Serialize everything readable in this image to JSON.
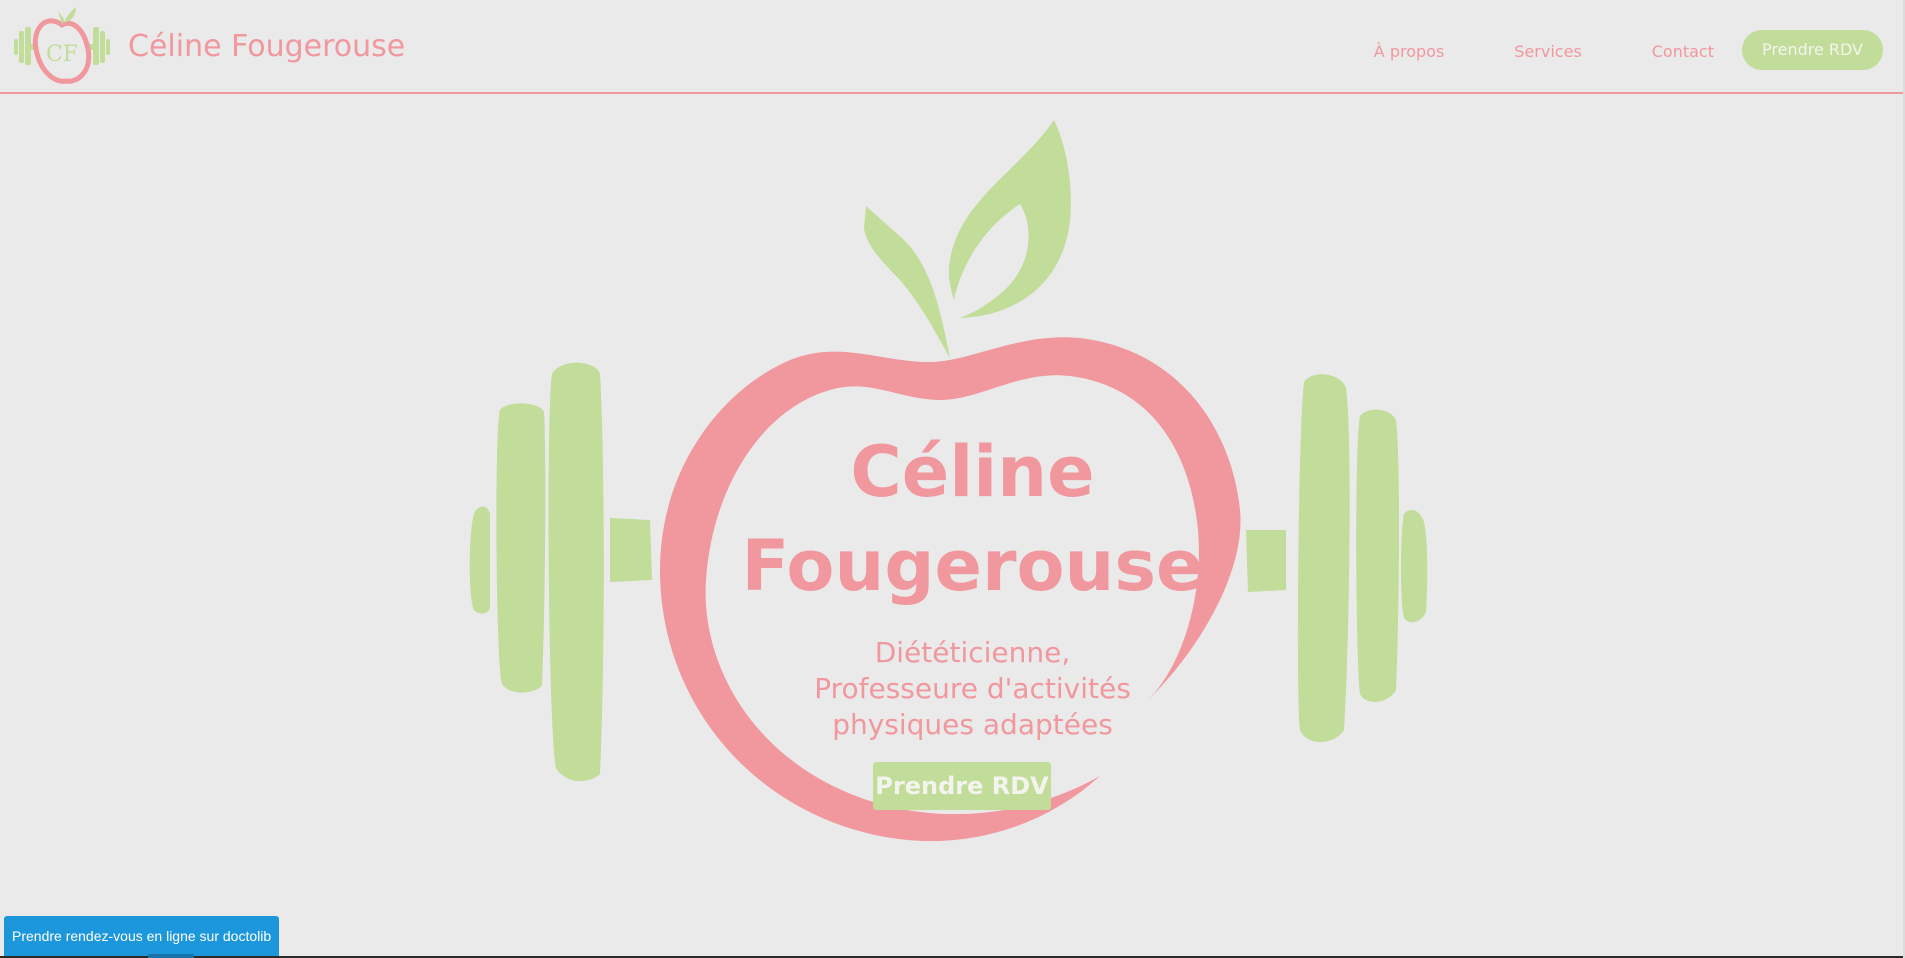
{
  "brand": {
    "name": "Céline Fougerouse",
    "logo_initials": "CF",
    "logo_icon": "apple-dumbbell-logo-icon"
  },
  "nav": {
    "items": [
      {
        "label": "À propos"
      },
      {
        "label": "Services"
      },
      {
        "label": "Contact"
      }
    ],
    "cta_label": "Prendre RDV"
  },
  "hero": {
    "name_line1": "Céline",
    "name_line2": "Fougerouse",
    "subtitle_line1": "Diététicienne,",
    "subtitle_line2": "Professeure d'activités",
    "subtitle_line3": "physiques adaptées",
    "cta_label": "Prendre RDV",
    "art_icon": "apple-dumbbell-illustration"
  },
  "doctolib": {
    "label": "Prendre rendez-vous en ligne sur doctolib"
  },
  "colors": {
    "pink": "#f1979e",
    "green": "#c2dc99",
    "background": "#eaeaea",
    "doctolib_blue": "#1c97dc"
  }
}
